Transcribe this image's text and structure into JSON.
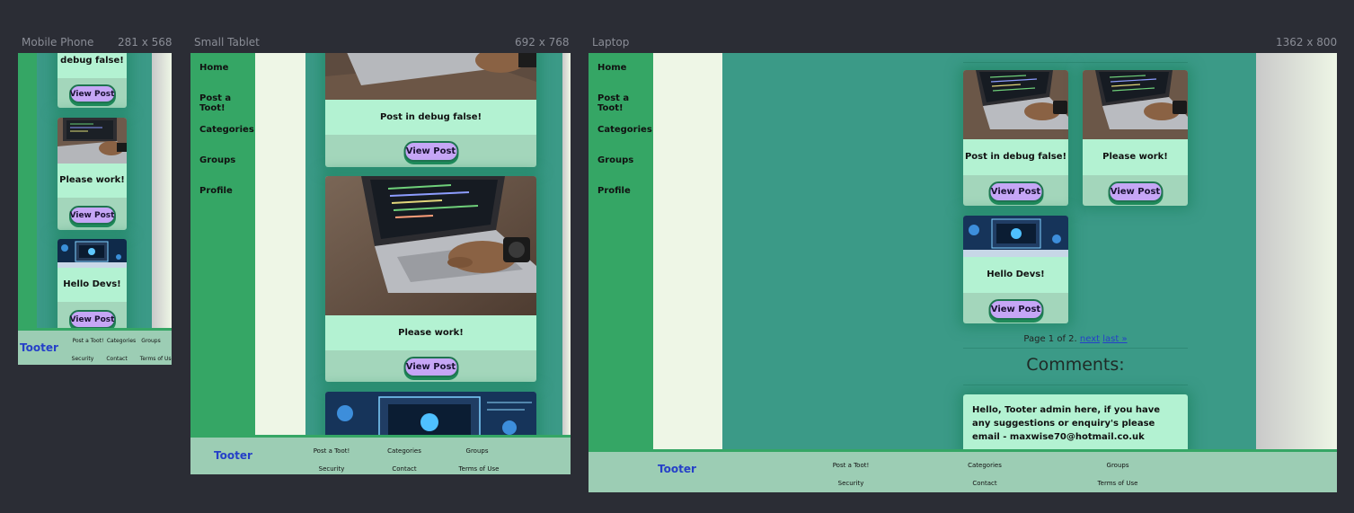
{
  "devices": {
    "mobile": {
      "name": "Mobile Phone",
      "size": "281 x 568"
    },
    "tablet": {
      "name": "Small Tablet",
      "size": "692 x 768"
    },
    "laptop": {
      "name": "Laptop",
      "size": "1362 x 800"
    }
  },
  "nav": {
    "items": [
      "Home",
      "Post a Toot!",
      "Categories",
      "Groups",
      "Profile"
    ]
  },
  "posts": [
    {
      "title": "Post in debug false!",
      "image": "laptop-photo"
    },
    {
      "title": "Please work!",
      "image": "laptop-photo"
    },
    {
      "title": "Hello Devs!",
      "image": "dev-banner"
    }
  ],
  "mobile_partial_title": "debug false!",
  "view_post_label": "View Post",
  "pagination": {
    "text": "Page 1 of 2.",
    "next": "next",
    "last": "last »"
  },
  "comments": {
    "heading": "Comments:",
    "items": [
      "Hello, Tooter admin here, if you have any suggestions or enquiry's please email - maxwise70@hotmail.co.uk"
    ]
  },
  "footer": {
    "brand": "Tooter",
    "links": [
      "Post a Toot!",
      "Categories",
      "Groups",
      "Security",
      "Contact",
      "Terms of Use"
    ]
  },
  "colors": {
    "background": "#2b2d35",
    "sidebar": "#35a665",
    "content_teal": "#3b9a87",
    "cream": "#eef6e6",
    "card": "#a3d6bb",
    "card_title": "#b3f2d2",
    "button": "#c6a6f6",
    "footer": "#9ccdb4",
    "brand_link": "#2540c8"
  }
}
